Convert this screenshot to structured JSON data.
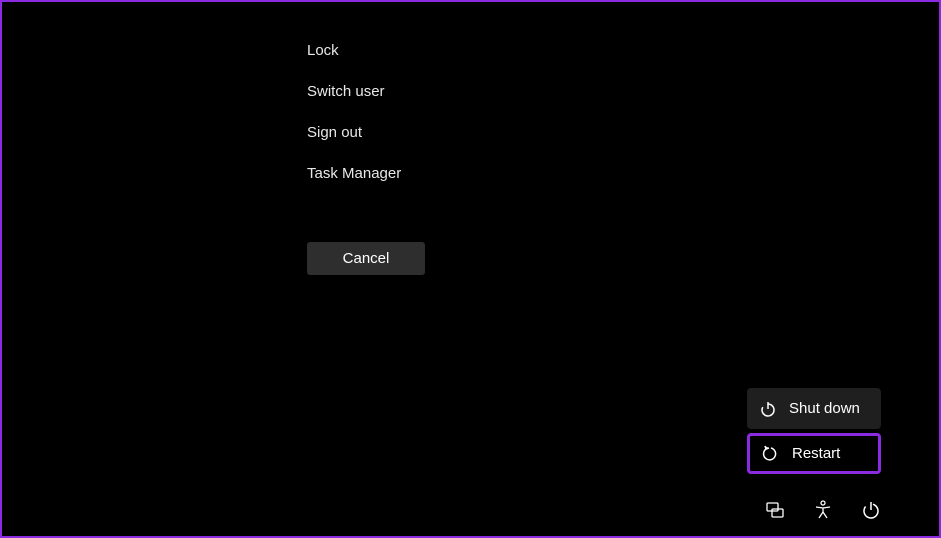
{
  "security_options": {
    "items": [
      {
        "label": "Lock"
      },
      {
        "label": "Switch user"
      },
      {
        "label": "Sign out"
      },
      {
        "label": "Task Manager"
      }
    ],
    "cancel_label": "Cancel"
  },
  "power_menu": {
    "items": [
      {
        "label": "Shut down",
        "highlighted": false
      },
      {
        "label": "Restart",
        "highlighted": true
      }
    ]
  },
  "colors": {
    "accent": "#8a2be2",
    "background": "#000000",
    "button_bg": "#2e2e2e",
    "menu_bg": "#1f1f1f"
  }
}
